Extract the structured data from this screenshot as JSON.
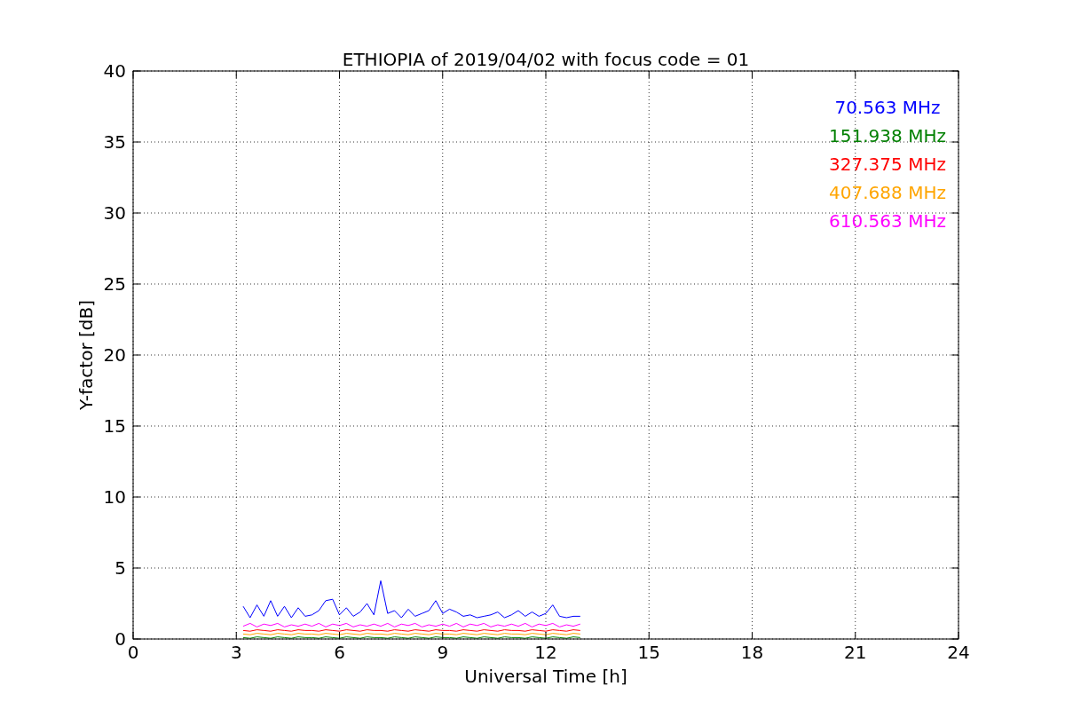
{
  "chart": {
    "chart_data": {
      "type": "line",
      "title": "ETHIOPIA of 2019/04/02 with focus code = 01",
      "xlabel": "Universal Time [h]",
      "ylabel": "Y-factor [dB]",
      "xlim": [
        0,
        24
      ],
      "ylim": [
        0,
        40
      ],
      "xticks": [
        0,
        3,
        6,
        9,
        12,
        15,
        18,
        21,
        24
      ],
      "yticks": [
        0,
        5,
        10,
        15,
        20,
        25,
        30,
        35,
        40
      ],
      "grid": true,
      "x": [
        3.2,
        3.4,
        3.6,
        3.8,
        4.0,
        4.2,
        4.4,
        4.6,
        4.8,
        5.0,
        5.2,
        5.4,
        5.6,
        5.8,
        6.0,
        6.2,
        6.4,
        6.6,
        6.8,
        7.0,
        7.2,
        7.4,
        7.6,
        7.8,
        8.0,
        8.2,
        8.4,
        8.6,
        8.8,
        9.0,
        9.2,
        9.4,
        9.6,
        9.8,
        10.0,
        10.2,
        10.4,
        10.6,
        10.8,
        11.0,
        11.2,
        11.4,
        11.6,
        11.8,
        12.0,
        12.2,
        12.4,
        12.6,
        12.8,
        13.0
      ],
      "series": [
        {
          "name": "70.563 MHz",
          "color": "#0000ff",
          "values": [
            2.3,
            1.5,
            2.4,
            1.6,
            2.7,
            1.6,
            2.3,
            1.5,
            2.2,
            1.6,
            1.7,
            2.0,
            2.7,
            2.8,
            1.7,
            2.2,
            1.6,
            1.9,
            2.5,
            1.7,
            4.1,
            1.8,
            2.0,
            1.5,
            2.1,
            1.6,
            1.8,
            2.0,
            2.7,
            1.8,
            2.1,
            1.9,
            1.6,
            1.7,
            1.5,
            1.6,
            1.7,
            1.9,
            1.5,
            1.7,
            2.0,
            1.6,
            1.9,
            1.6,
            1.8,
            2.4,
            1.6,
            1.5,
            1.6,
            1.6
          ]
        },
        {
          "name": "151.938 MHz",
          "color": "#008000",
          "values": [
            0.1,
            0.05,
            0.15,
            0.1,
            0.05,
            0.15,
            0.1,
            0.05,
            0.15,
            0.1,
            0.1,
            0.05,
            0.15,
            0.1,
            0.05,
            0.15,
            0.1,
            0.05,
            0.15,
            0.1,
            0.1,
            0.05,
            0.15,
            0.1,
            0.05,
            0.15,
            0.1,
            0.05,
            0.15,
            0.1,
            0.1,
            0.05,
            0.15,
            0.1,
            0.05,
            0.15,
            0.1,
            0.05,
            0.15,
            0.1,
            0.1,
            0.05,
            0.15,
            0.1,
            0.05,
            0.15,
            0.1,
            0.05,
            0.15,
            0.1
          ]
        },
        {
          "name": "327.375 MHz",
          "color": "#ff0000",
          "values": [
            0.6,
            0.55,
            0.65,
            0.6,
            0.55,
            0.65,
            0.6,
            0.55,
            0.65,
            0.6,
            0.6,
            0.55,
            0.65,
            0.6,
            0.55,
            0.65,
            0.6,
            0.55,
            0.65,
            0.6,
            0.6,
            0.55,
            0.65,
            0.6,
            0.55,
            0.65,
            0.6,
            0.55,
            0.65,
            0.6,
            0.6,
            0.55,
            0.65,
            0.6,
            0.55,
            0.65,
            0.6,
            0.55,
            0.65,
            0.6,
            0.6,
            0.55,
            0.65,
            0.6,
            0.55,
            0.65,
            0.6,
            0.55,
            0.65,
            0.6
          ]
        },
        {
          "name": "407.688 MHz",
          "color": "#ffa500",
          "values": [
            0.35,
            0.3,
            0.4,
            0.35,
            0.3,
            0.4,
            0.35,
            0.3,
            0.4,
            0.35,
            0.35,
            0.3,
            0.4,
            0.35,
            0.3,
            0.4,
            0.35,
            0.3,
            0.4,
            0.35,
            0.35,
            0.3,
            0.4,
            0.35,
            0.3,
            0.4,
            0.35,
            0.3,
            0.4,
            0.35,
            0.35,
            0.3,
            0.4,
            0.35,
            0.3,
            0.4,
            0.35,
            0.3,
            0.4,
            0.35,
            0.35,
            0.3,
            0.4,
            0.35,
            0.3,
            0.4,
            0.35,
            0.3,
            0.4,
            0.35
          ]
        },
        {
          "name": "610.563 MHz",
          "color": "#ff00ff",
          "values": [
            0.9,
            1.1,
            0.85,
            1.05,
            0.95,
            1.1,
            0.85,
            1.0,
            0.9,
            1.05,
            0.9,
            1.1,
            0.85,
            1.05,
            0.95,
            1.1,
            0.85,
            1.0,
            0.9,
            1.05,
            0.9,
            1.1,
            0.85,
            1.05,
            0.95,
            1.1,
            0.85,
            1.0,
            0.9,
            1.05,
            0.9,
            1.1,
            0.85,
            1.05,
            0.95,
            1.1,
            0.85,
            1.0,
            0.9,
            1.05,
            0.9,
            1.1,
            0.85,
            1.05,
            0.95,
            1.1,
            0.85,
            1.0,
            0.9,
            1.05
          ]
        }
      ]
    }
  }
}
